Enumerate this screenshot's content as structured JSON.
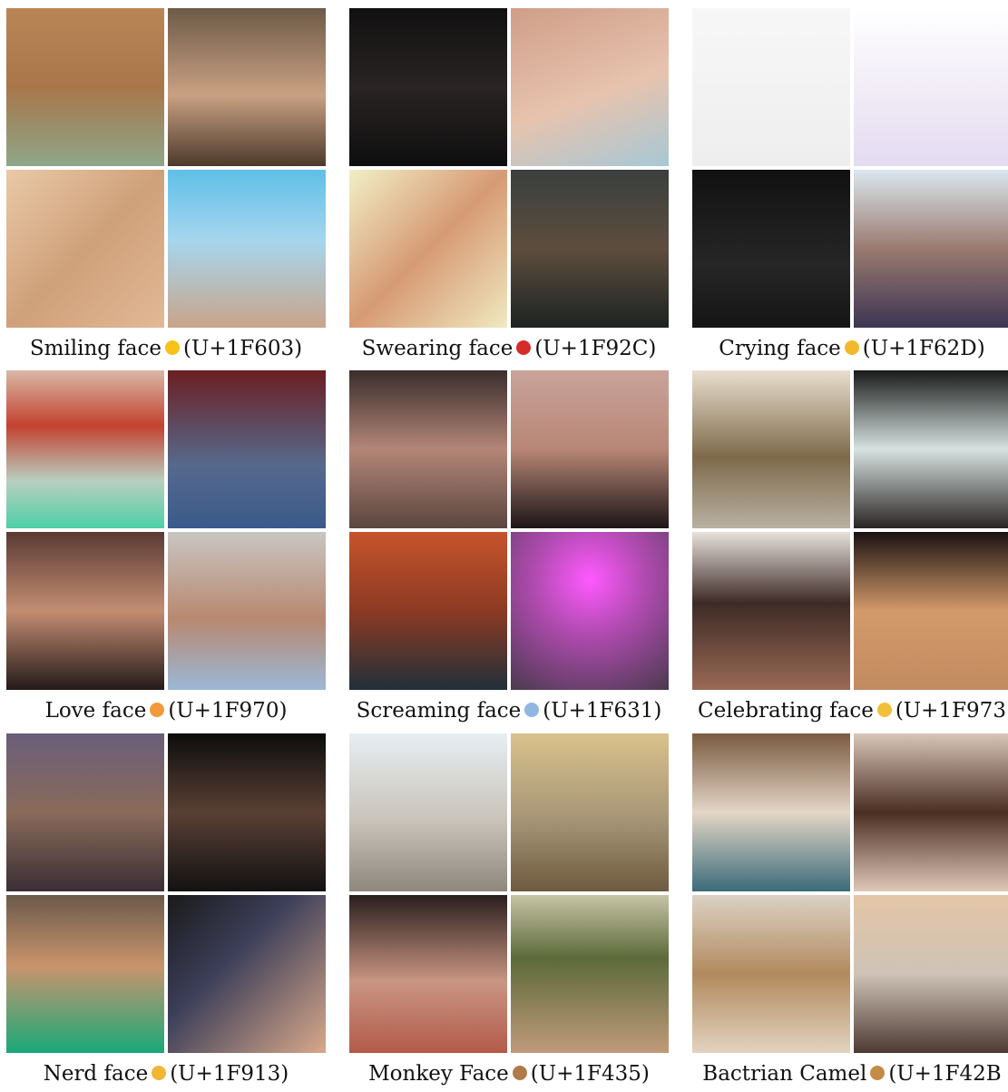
{
  "groups": [
    {
      "name": "Smiling face",
      "code": "(U+1F603)",
      "emoji_color": "#f7c21a",
      "tiles": [
        {
          "bg": "linear-gradient(180deg,#b88656 0%,#a8764a 50%,#8ea78a 100%)",
          "icon": "portrait-icon"
        },
        {
          "bg": "linear-gradient(180deg,#6d5a48 0%,#c9a182 55%,#4d3a2c 100%)",
          "icon": "portrait-icon"
        },
        {
          "bg": "linear-gradient(135deg,#e9c9a8 0%,#cfa17a 50%,#e2b895 100%)",
          "icon": "drawing-icon"
        },
        {
          "bg": "linear-gradient(180deg,#5fbfe8 0%,#a6d6ee 45%,#c8a48a 100%)",
          "icon": "portrait-icon"
        }
      ]
    },
    {
      "name": "Swearing face",
      "code": "(U+1F92C)",
      "emoji_color": "#d62b2b",
      "tiles": [
        {
          "bg": "linear-gradient(180deg,#101010 0%,#2a2424 50%,#0e0e0e 100%)",
          "icon": "portrait-icon"
        },
        {
          "bg": "linear-gradient(160deg,#cf9e88 0%,#e7c3ae 55%,#a7c8d6 100%)",
          "icon": "face-closeup-icon"
        },
        {
          "bg": "linear-gradient(135deg,#f2efc6 0%,#d69a74 50%,#f0e9c0 100%)",
          "icon": "fist-icon"
        },
        {
          "bg": "linear-gradient(180deg,#3a3f3e 0%,#5e4d3e 50%,#1d2322 100%)",
          "icon": "portrait-icon"
        }
      ]
    },
    {
      "name": "Crying face",
      "code": "(U+1F62D)",
      "emoji_color": "#f3b82b",
      "tiles": [
        {
          "bg": "linear-gradient(180deg,#f7f7f7 0%,#eeeeee 100%)",
          "icon": "sketch-icon"
        },
        {
          "bg": "linear-gradient(180deg,#ffffff 0%,#efe9f5 60%,#e4dbf1 100%)",
          "icon": "text-art-icon"
        },
        {
          "bg": "linear-gradient(180deg,#111 0%,#262626 60%,#151515 100%)",
          "icon": "drawing-icon"
        },
        {
          "bg": "linear-gradient(180deg,#dbe7ef 0%,#9a7a70 50%,#3c3552 100%)",
          "icon": "portrait-icon"
        }
      ]
    },
    {
      "name": "Love face",
      "code": "(U+1F970)",
      "emoji_color": "#f19a3a",
      "tiles": [
        {
          "bg": "linear-gradient(180deg,#d9b8a6 0%,#c3412f 35%,#b9cfc0 70%,#4dcfa6 100%)",
          "icon": "face-closeup-icon"
        },
        {
          "bg": "linear-gradient(180deg,#6b1f22 0%,#56698c 60%,#3a5a8b 100%)",
          "icon": "heart-icon"
        },
        {
          "bg": "linear-gradient(180deg,#5a3a34 0%,#c48d72 50%,#241a1a 100%)",
          "icon": "portrait-icon"
        },
        {
          "bg": "linear-gradient(180deg,#c9c6c3 0%,#b88870 55%,#9bb8d6 100%)",
          "icon": "portrait-icon"
        }
      ]
    },
    {
      "name": "Screaming face",
      "code": "(U+1F631)",
      "emoji_color": "#8fb7e0",
      "tiles": [
        {
          "bg": "linear-gradient(180deg,#3a2d2d 0%,#b48677 50%,#5a4640 100%)",
          "icon": "portrait-icon"
        },
        {
          "bg": "linear-gradient(180deg,#c9a49a 0%,#b88676 50%,#1c1516 100%)",
          "icon": "portrait-icon"
        },
        {
          "bg": "linear-gradient(180deg,#c6542c 0%,#8c3a23 50%,#21303a 100%)",
          "icon": "portrait-icon"
        },
        {
          "bg": "radial-gradient(circle at 50% 30%,#ff59ff 0%,#b24bb2 40%,#4a3a4e 100%)",
          "icon": "portrait-icon"
        }
      ]
    },
    {
      "name": "Celebrating face",
      "code": "(U+1F973",
      "emoji_color": "#f2c038",
      "tiles": [
        {
          "bg": "linear-gradient(180deg,#e9dfcf 0%,#7e6a4a 55%,#b9b1a2 100%)",
          "icon": "portrait-icon"
        },
        {
          "bg": "linear-gradient(180deg,#1a1a1a 0%,#d6e3e0 50%,#2a2424 100%)",
          "icon": "glowing-smile-icon"
        },
        {
          "bg": "linear-gradient(180deg,#e8e1dc 0%,#3d2a26 45%,#9a6a55 100%)",
          "icon": "portrait-icon"
        },
        {
          "bg": "linear-gradient(180deg,#1a1212 0%,#d39a6a 50%,#c28b60 100%)",
          "icon": "candy-icon"
        }
      ]
    },
    {
      "name": "Nerd face",
      "code": "(U+1F913)",
      "emoji_color": "#f0b634",
      "tiles": [
        {
          "bg": "linear-gradient(180deg,#6a5e7a 0%,#8a6b5a 50%,#3a2e35 100%)",
          "icon": "portrait-icon"
        },
        {
          "bg": "linear-gradient(180deg,#0c0c0c 0%,#5a4034 50%,#121212 100%)",
          "icon": "portrait-icon"
        },
        {
          "bg": "linear-gradient(180deg,#6b5a4a 0%,#c9946d 45%,#19a979 100%)",
          "icon": "portrait-icon"
        },
        {
          "bg": "linear-gradient(135deg,#1a1a1a 0%,#3d3f5a 40%,#d9a98a 100%)",
          "icon": "portrait-icon"
        }
      ]
    },
    {
      "name": "Monkey Face",
      "code": "(U+1F435)",
      "emoji_color": "#b07a4a",
      "tiles": [
        {
          "bg": "linear-gradient(180deg,#e7eef2 0%,#c9c3ba 55%,#8e877c 100%)",
          "icon": "monkey-icon"
        },
        {
          "bg": "linear-gradient(180deg,#d9c28c 0%,#a69576 55%,#6e5a3e 100%)",
          "icon": "monkey-icon"
        },
        {
          "bg": "linear-gradient(180deg,#2a1e1e 0%,#c99682 55%,#b35a4a 100%)",
          "icon": "portrait-icon"
        },
        {
          "bg": "linear-gradient(180deg,#c7c4a6 0%,#5c6a3a 40%,#c09a7a 100%)",
          "icon": "chimp-icon"
        }
      ]
    },
    {
      "name": "Bactrian Camel",
      "code": "(U+1F42B",
      "emoji_color": "#c58a45",
      "tiles": [
        {
          "bg": "linear-gradient(180deg,#7a5a40 0%,#e4d6c6 50%,#3a6b7a 100%)",
          "icon": "camel-icon"
        },
        {
          "bg": "linear-gradient(180deg,#d9c6b9 0%,#4a2e22 50%,#e0c7b8 100%)",
          "icon": "camel-icon"
        },
        {
          "bg": "linear-gradient(180deg,#dcd2c4 0%,#b28a5e 50%,#e2d3bf 100%)",
          "icon": "camel-icon"
        },
        {
          "bg": "linear-gradient(180deg,#e4c6a6 0%,#cec3b6 50%,#4d3a33 100%)",
          "icon": "camel-icon"
        }
      ]
    }
  ]
}
